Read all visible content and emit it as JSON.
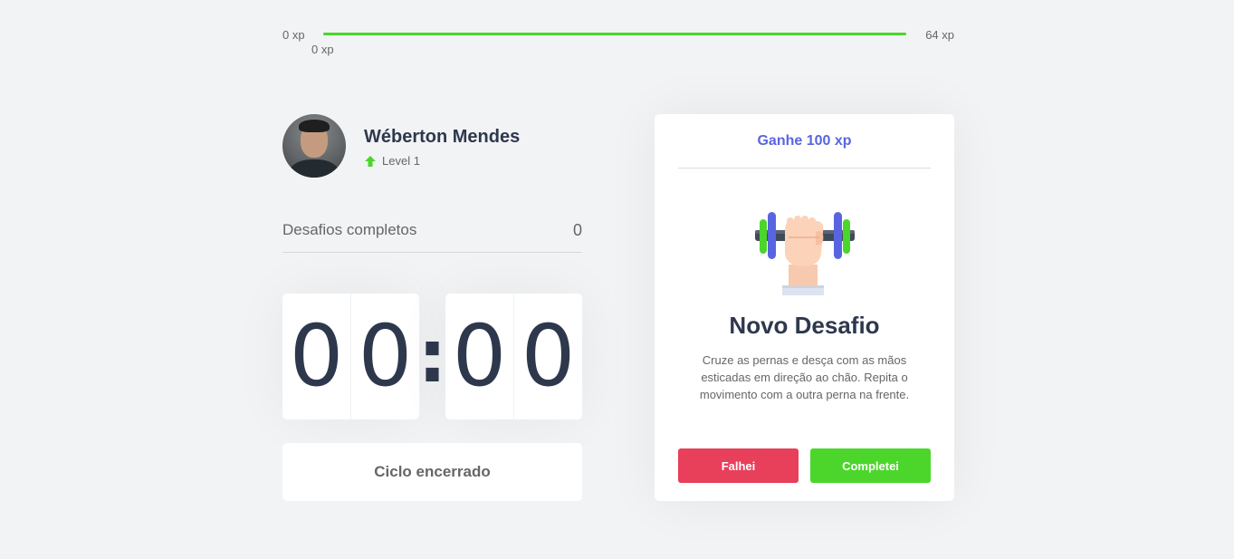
{
  "experience": {
    "min_label": "0 xp",
    "max_label": "64 xp",
    "current_label": "0 xp",
    "progress_fraction": 1.0,
    "bar_color": "#4cd62b"
  },
  "profile": {
    "name": "Wéberton Mendes",
    "level_label": "Level 1",
    "level_icon": "level-up-arrow-icon"
  },
  "completed_challenges": {
    "label": "Desafios completos",
    "count": "0"
  },
  "countdown": {
    "minutes": [
      "0",
      "0"
    ],
    "separator": ":",
    "seconds": [
      "0",
      "0"
    ]
  },
  "cycle_button": {
    "label": "Ciclo encerrado"
  },
  "challenge": {
    "reward_label": "Ganhe 100 xp",
    "illustration_icon": "dumbbell-hand-icon",
    "title": "Novo Desafio",
    "description": "Cruze as pernas e desça com as mãos esticadas em direção ao chão. Repita o movimento com a outra perna na frente.",
    "fail_label": "Falhei",
    "success_label": "Completei"
  },
  "colors": {
    "background": "#f2f3f5",
    "title_text": "#2e384d",
    "body_text": "#666666",
    "accent_blue": "#5965e0",
    "success_green": "#4cd62b",
    "fail_red": "#e83f5b"
  }
}
